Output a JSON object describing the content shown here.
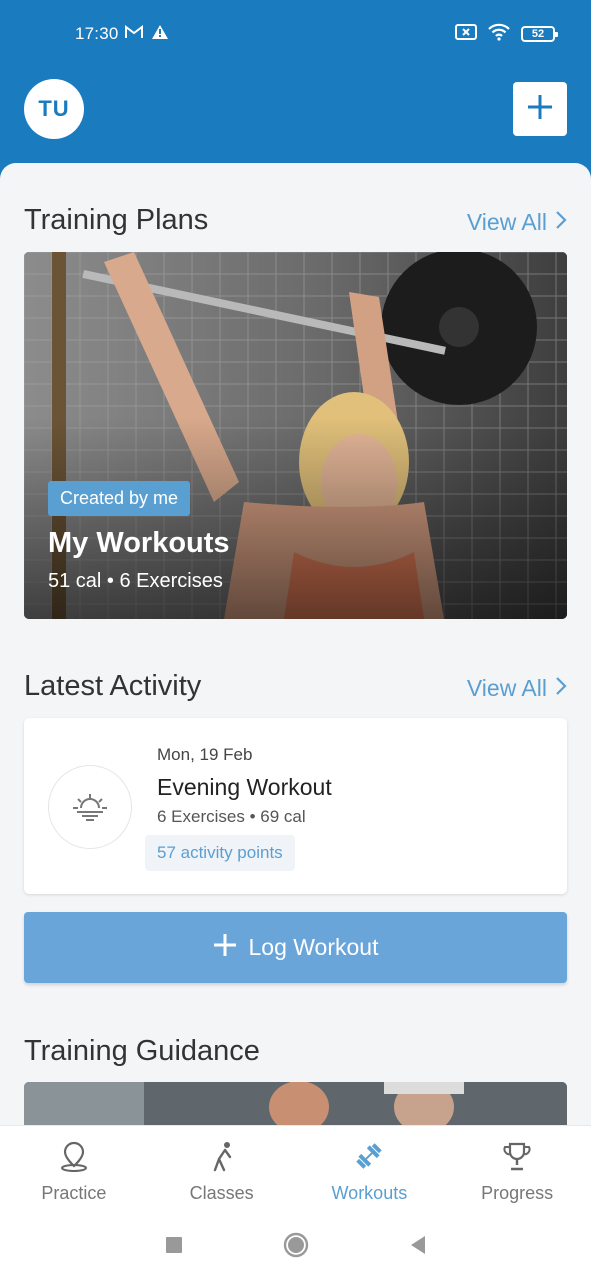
{
  "status_bar": {
    "time": "17:30",
    "battery": "52"
  },
  "header": {
    "avatar_initials": "TU"
  },
  "training_plans": {
    "title": "Training Plans",
    "view_all": "View All",
    "card": {
      "badge": "Created by me",
      "title": "My Workouts",
      "subtitle": "51 cal • 6 Exercises"
    }
  },
  "latest_activity": {
    "title": "Latest Activity",
    "view_all": "View All",
    "item": {
      "date": "Mon, 19 Feb",
      "title": "Evening Workout",
      "meta": "6 Exercises • 69 cal",
      "points": "57 activity points"
    }
  },
  "log_workout": {
    "label": "Log Workout"
  },
  "training_guidance": {
    "title": "Training Guidance"
  },
  "bottom_nav": {
    "items": [
      {
        "label": "Practice",
        "icon": "location-pin-icon"
      },
      {
        "label": "Classes",
        "icon": "stretch-person-icon"
      },
      {
        "label": "Workouts",
        "icon": "dumbbell-icon",
        "active": true
      },
      {
        "label": "Progress",
        "icon": "trophy-icon"
      }
    ]
  },
  "colors": {
    "brand": "#1b7bbf",
    "accent": "#5a9fd1",
    "button": "#6aa5da"
  }
}
